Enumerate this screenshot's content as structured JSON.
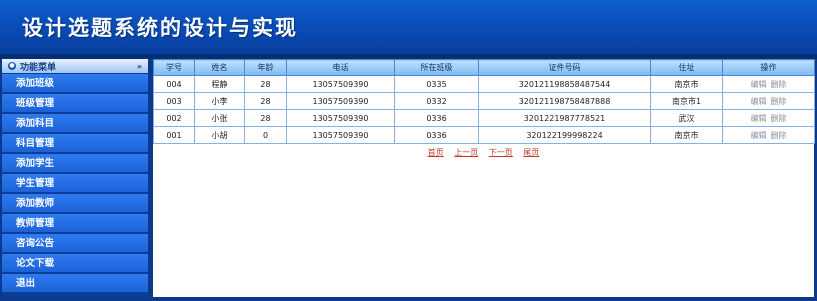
{
  "header": {
    "title": "设计选题系统的设计与实现"
  },
  "sidebar": {
    "head_label": "功能菜单",
    "items": [
      "添加班级",
      "班级管理",
      "添加科目",
      "科目管理",
      "添加学生",
      "学生管理",
      "添加教师",
      "教师管理",
      "咨询公告",
      "论文下载",
      "退出"
    ]
  },
  "table": {
    "columns": [
      "学号",
      "姓名",
      "年龄",
      "电话",
      "所在班级",
      "证件号码",
      "住址",
      "操作"
    ],
    "rows": [
      {
        "id": "004",
        "name": "程静",
        "age": "28",
        "phone": "13057509390",
        "class": "0335",
        "cert": "320121198858487544",
        "addr": "南京市"
      },
      {
        "id": "003",
        "name": "小李",
        "age": "28",
        "phone": "13057509390",
        "class": "0332",
        "cert": "320121198758487888",
        "addr": "南京市1"
      },
      {
        "id": "002",
        "name": "小张",
        "age": "28",
        "phone": "13057509390",
        "class": "0336",
        "cert": "3201221987778521",
        "addr": "武汉"
      },
      {
        "id": "001",
        "name": "小胡",
        "age": "0",
        "phone": "13057509390",
        "class": "0336",
        "cert": "320122199998224",
        "addr": "南京市"
      }
    ],
    "edit_label": "编辑",
    "delete_label": "删除"
  },
  "pager": {
    "first": "首页",
    "prev": "上一页",
    "next": "下一页",
    "last": "尾页"
  }
}
